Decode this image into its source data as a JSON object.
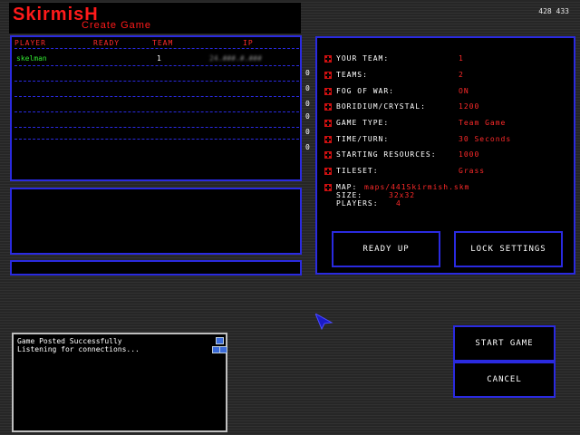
{
  "header": {
    "title": "SkirmisH",
    "subtitle": "Create Game",
    "coords": "428 433"
  },
  "players": {
    "columns": [
      "PLAYER",
      "READY",
      "TEAM",
      "IP"
    ],
    "rows": [
      {
        "name": "skelman",
        "ready": "",
        "team": "1",
        "ip": "24.###.#.###"
      }
    ],
    "counts": [
      "0",
      "0",
      "0",
      "0",
      "0",
      "0"
    ]
  },
  "settings": {
    "items": [
      {
        "label": "YOUR TEAM:",
        "value": "1"
      },
      {
        "label": "TEAMS:",
        "value": "2"
      },
      {
        "label": "FOG OF WAR:",
        "value": "ON"
      },
      {
        "label": "BORIDIUM/CRYSTAL:",
        "value": "1200"
      },
      {
        "label": "GAME TYPE:",
        "value": "Team Game"
      },
      {
        "label": "TIME/TURN:",
        "value": "30 Seconds"
      },
      {
        "label": "STARTING RESOURCES:",
        "value": "1000"
      },
      {
        "label": "TILESET:",
        "value": "Grass"
      }
    ],
    "map": {
      "map_label": "MAP:",
      "map_value": "maps/441Skirmish.skm",
      "size_label": "SIZE:",
      "size_value": "32x32",
      "players_label": "PLAYERS:",
      "players_value": "4"
    }
  },
  "buttons": {
    "ready_up": "READY UP",
    "lock_settings": "LOCK SETTINGS",
    "start_game": "START GAME",
    "cancel": "CANCEL"
  },
  "log": {
    "lines": [
      "Game Posted Successfully",
      "Listening for connections..."
    ]
  },
  "colors": {
    "panel_border": "#2a2ae0",
    "accent_red": "#ff2a2a",
    "player_green": "#32e632"
  }
}
